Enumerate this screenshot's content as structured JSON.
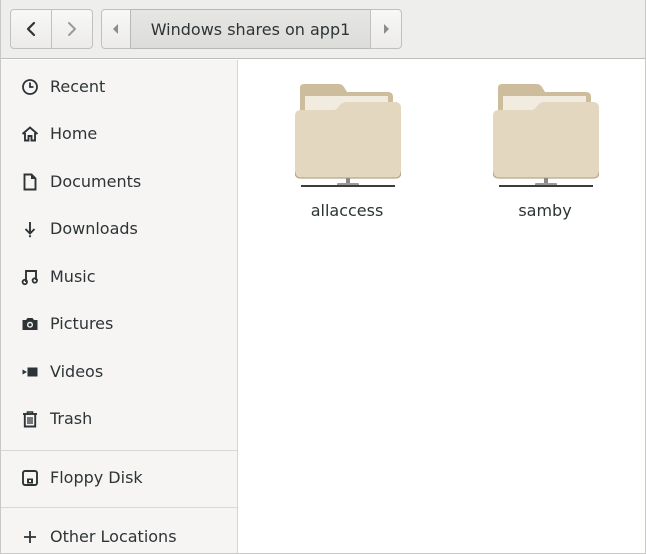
{
  "header": {
    "path_current": "Windows shares on app1",
    "back_icon": "chevron-left-icon",
    "forward_icon": "chevron-right-icon"
  },
  "sidebar": {
    "items": [
      {
        "label": "Recent",
        "icon": "clock-icon"
      },
      {
        "label": "Home",
        "icon": "home-icon"
      },
      {
        "label": "Documents",
        "icon": "document-icon"
      },
      {
        "label": "Downloads",
        "icon": "download-icon"
      },
      {
        "label": "Music",
        "icon": "music-icon"
      },
      {
        "label": "Pictures",
        "icon": "camera-icon"
      },
      {
        "label": "Videos",
        "icon": "video-icon"
      },
      {
        "label": "Trash",
        "icon": "trash-icon"
      },
      {
        "label": "Floppy Disk",
        "icon": "floppy-disk-icon"
      },
      {
        "label": "Other Locations",
        "icon": "plus-icon"
      }
    ]
  },
  "main": {
    "shares": [
      {
        "label": "allaccess",
        "icon": "network-folder-icon"
      },
      {
        "label": "samby",
        "icon": "network-folder-icon"
      }
    ]
  },
  "colors": {
    "folder_back": "#cdbd9c",
    "folder_front": "#e4d7bf",
    "sidebar_bg": "#f6f5f4",
    "header_bg": "#eeeeec",
    "text": "#2e3436"
  }
}
